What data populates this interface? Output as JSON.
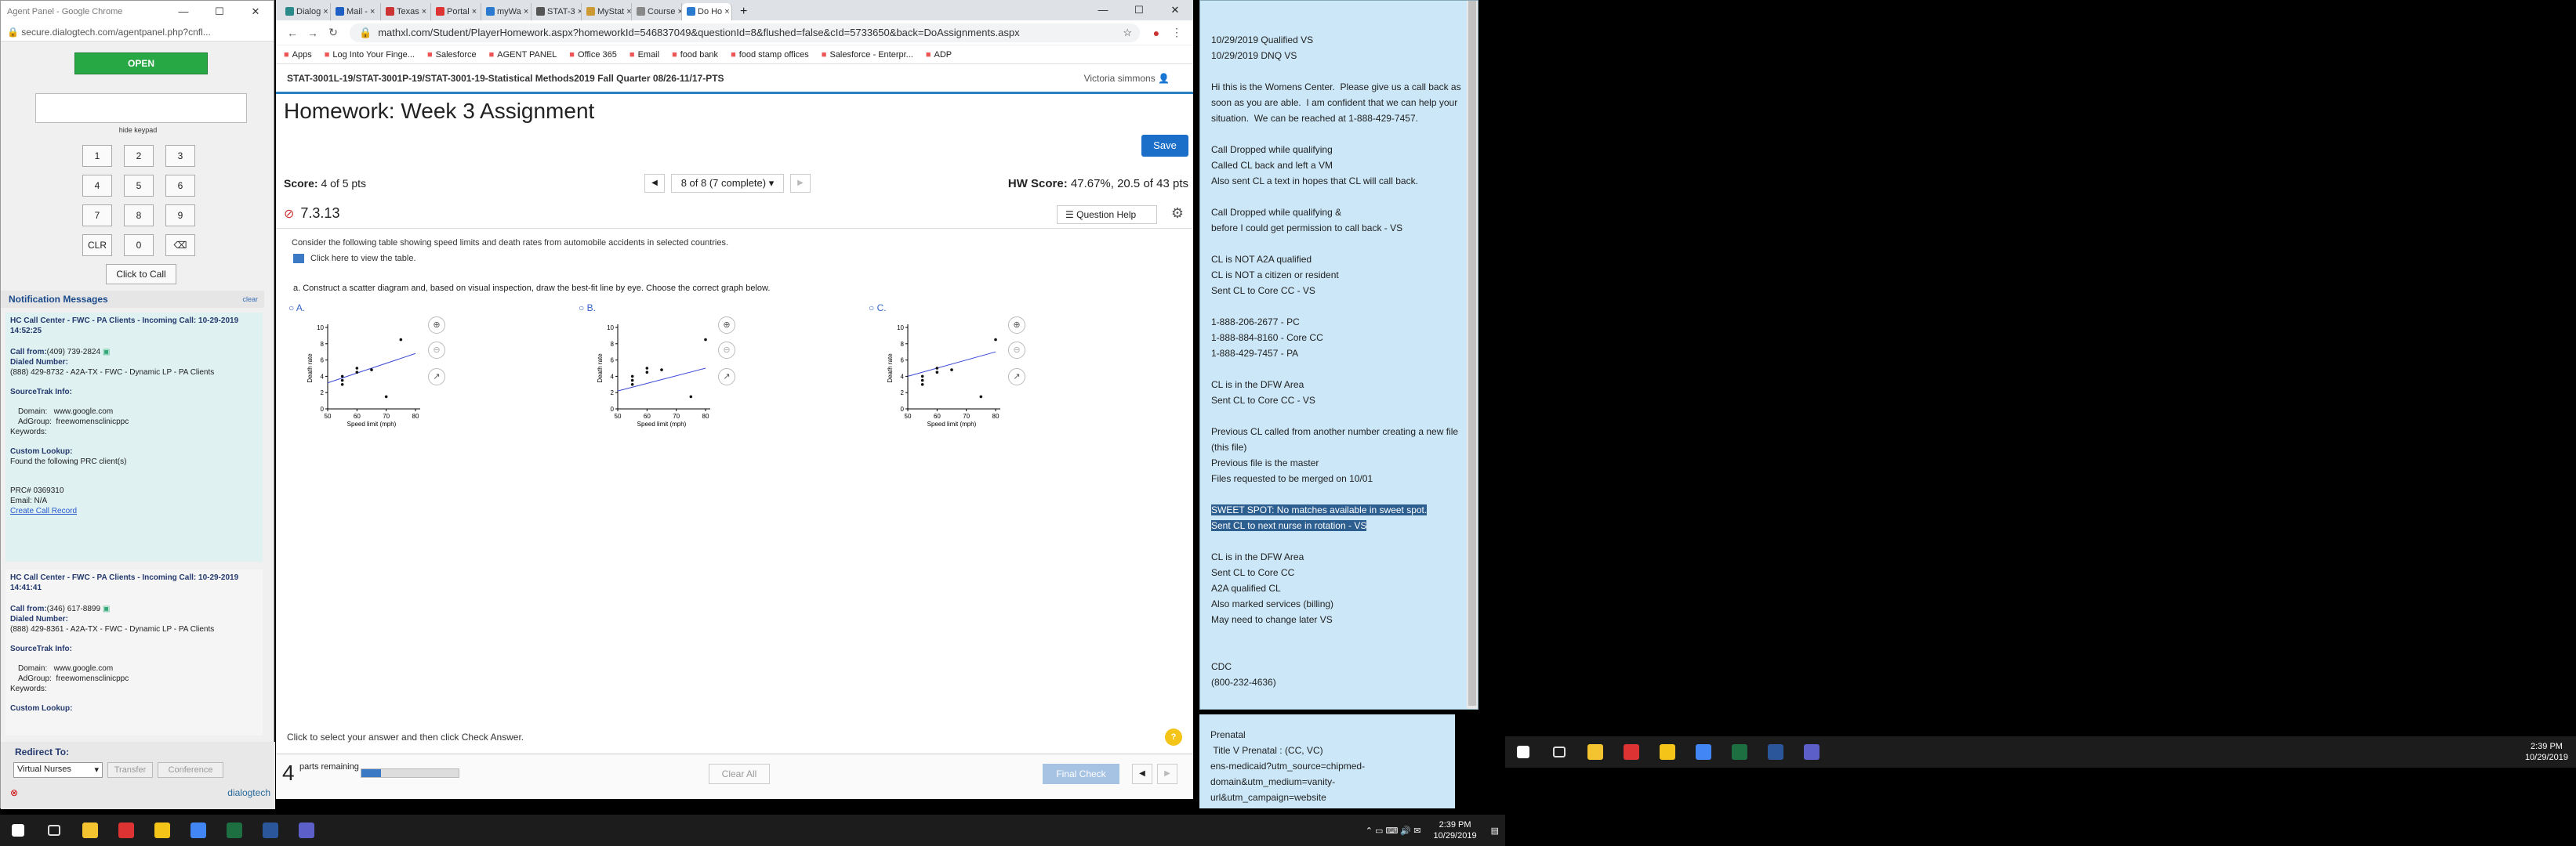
{
  "agent": {
    "window_title": "Agent Panel - Google Chrome",
    "url": "secure.dialogtech.com/agentpanel.php?cnfl...",
    "open_label": "OPEN",
    "hide_keypad": "hide keypad",
    "keys": [
      "1",
      "2",
      "3",
      "4",
      "5",
      "6",
      "7",
      "8",
      "9",
      "CLR",
      "0",
      "⌫"
    ],
    "click_to_call": "Click to Call",
    "notifications_title": "Notification Messages",
    "clear": "clear",
    "n1": {
      "header": "HC Call Center - FWC - PA Clients - Incoming Call: 10-29-2019 14:52:25",
      "call_from_label": "Call from:",
      "call_from": "(409) 739-2824",
      "dialed_label": "Dialed Number:",
      "dialed": "(888) 429-8732 - A2A-TX - FWC - Dynamic LP - PA Clients",
      "sourcetrak": "SourceTrak Info:",
      "domain_label": "Domain:",
      "domain": "www.google.com",
      "adgroup_label": "AdGroup:",
      "adgroup": "freewomensclinicppc",
      "keywords_label": "Keywords:",
      "custom_label": "Custom Lookup:",
      "custom": "Found the following PRC client(s)",
      "prc": "PRC# 0369310",
      "email": "Email: N/A",
      "create": "Create Call Record"
    },
    "n2": {
      "header": "HC Call Center - FWC - PA Clients - Incoming Call: 10-29-2019 14:41:41",
      "call_from_label": "Call from:",
      "call_from": "(346) 617-8899",
      "dialed_label": "Dialed Number:",
      "dialed": "(888) 429-8361 - A2A-TX - FWC - Dynamic LP - PA Clients",
      "sourcetrak": "SourceTrak Info:",
      "domain_label": "Domain:",
      "domain": "www.google.com",
      "adgroup_label": "AdGroup:",
      "adgroup": "freewomensclinicppc",
      "keywords_label": "Keywords:",
      "custom_label": "Custom Lookup:"
    },
    "redirect_label": "Redirect To:",
    "redirect_value": "Virtual Nurses",
    "transfer": "Transfer",
    "conference": "Conference",
    "brand": "dialogtech"
  },
  "browser": {
    "tabs": [
      {
        "label": "Dialog",
        "color": "#2a8a8a"
      },
      {
        "label": "Mail -",
        "color": "#1e5fc4"
      },
      {
        "label": "Texas",
        "color": "#c33"
      },
      {
        "label": "Portal",
        "color": "#d33"
      },
      {
        "label": "myWa",
        "color": "#2a7bd0"
      },
      {
        "label": "STAT-3",
        "color": "#555"
      },
      {
        "label": "MyStat",
        "color": "#c93"
      },
      {
        "label": "Course",
        "color": "#888"
      },
      {
        "label": "Do Ho",
        "color": "#2a7bd0"
      }
    ],
    "url": "mathxl.com/Student/PlayerHomework.aspx?homeworkId=546837049&questionId=8&flushed=false&cId=5733650&back=DoAssignments.aspx",
    "bookmarks": [
      "Apps",
      "Log Into Your Finge...",
      "Salesforce",
      "AGENT PANEL",
      "Office 365",
      "Email",
      "food bank",
      "food stamp offices",
      "Salesforce - Enterpr...",
      "ADP"
    ],
    "course": "STAT-3001L-19/STAT-3001P-19/STAT-3001-19-Statistical Methods2019 Fall Quarter 08/26-11/17-PTS",
    "user": "Victoria simmons",
    "hw_title": "Homework: Week 3 Assignment",
    "save": "Save",
    "score_label": "Score:",
    "score": "4 of 5 pts",
    "pager": "8 of 8 (7 complete)",
    "hw_score_label": "HW Score:",
    "hw_score": "47.67%, 20.5 of 43 pts",
    "question_num": "7.3.13",
    "question_help": "Question Help",
    "question_text": "Consider the following table showing speed limits and death rates from automobile accidents in selected countries.",
    "table_link": "Click here to view the table.",
    "part_a": "a. Construct a scatter diagram and, based on visual inspection, draw the best-fit line by eye. Choose the correct graph below.",
    "options": [
      "A.",
      "B.",
      "C."
    ],
    "bottom_hint": "Click to select your answer and then click Check Answer.",
    "parts_num": "4",
    "parts_text": "parts remaining",
    "progress": 0.2,
    "clear_all": "Clear All",
    "final_check": "Final Check"
  },
  "chart_data": [
    {
      "type": "scatter",
      "xlabel": "Speed limit (mph)",
      "ylabel": "Death rate",
      "xlim": [
        50,
        80
      ],
      "ylim": [
        0,
        10
      ],
      "xticks": [
        50,
        60,
        70,
        80
      ],
      "yticks": [
        0,
        2,
        4,
        6,
        8,
        10
      ],
      "points": [
        [
          55,
          3.0
        ],
        [
          55,
          3.5
        ],
        [
          55,
          4.0
        ],
        [
          60,
          4.5
        ],
        [
          60,
          5.0
        ],
        [
          65,
          4.8
        ],
        [
          70,
          1.5
        ],
        [
          75,
          8.5
        ]
      ],
      "line": [
        [
          50,
          3.2
        ],
        [
          80,
          6.8
        ]
      ]
    },
    {
      "type": "scatter",
      "xlabel": "Speed limit (mph)",
      "ylabel": "Death rate",
      "xlim": [
        50,
        80
      ],
      "ylim": [
        0,
        10
      ],
      "xticks": [
        50,
        60,
        70,
        80
      ],
      "yticks": [
        0,
        2,
        4,
        6,
        8,
        10
      ],
      "points": [
        [
          55,
          3.0
        ],
        [
          55,
          3.5
        ],
        [
          55,
          4.0
        ],
        [
          60,
          4.5
        ],
        [
          60,
          5.0
        ],
        [
          65,
          4.8
        ],
        [
          75,
          1.5
        ],
        [
          80,
          8.5
        ]
      ],
      "line": [
        [
          50,
          2.2
        ],
        [
          80,
          5.0
        ]
      ]
    },
    {
      "type": "scatter",
      "xlabel": "Speed limit (mph)",
      "ylabel": "Death rate",
      "xlim": [
        50,
        80
      ],
      "ylim": [
        0,
        10
      ],
      "xticks": [
        50,
        60,
        70,
        80
      ],
      "yticks": [
        0,
        2,
        4,
        6,
        8,
        10
      ],
      "points": [
        [
          55,
          3.0
        ],
        [
          55,
          3.5
        ],
        [
          55,
          4.0
        ],
        [
          60,
          4.5
        ],
        [
          60,
          5.0
        ],
        [
          65,
          4.8
        ],
        [
          75,
          1.5
        ],
        [
          80,
          8.5
        ]
      ],
      "line": [
        [
          50,
          4.0
        ],
        [
          80,
          7.0
        ]
      ]
    }
  ],
  "notes": {
    "text_before": "10/29/2019 Qualified VS\n10/29/2019 DNQ VS\n\nHi this is the Womens Center.  Please give us a call back as soon as you are able.  I am confident that we can help your situation.  We can be reached at 1-888-429-7457.\n\nCall Dropped while qualifying\nCalled CL back and left a VM\nAlso sent CL a text in hopes that CL will call back.\n\nCall Dropped while qualifying &\nbefore I could get permission to call back - VS\n\nCL is NOT A2A qualified\nCL is NOT a citizen or resident\nSent CL to Core CC - VS\n\n1-888-206-2677 - PC\n1-888-884-8160 - Core CC\n1-888-429-7457 - PA\n\nCL is in the DFW Area\nSent CL to Core CC - VS\n\nPrevious CL called from another number creating a new file (this file)\nPrevious file is the master\nFiles requested to be merged on 10/01\n\n",
    "highlight": "SWEET SPOT: No matches available in sweet spot.\nSent CL to next nurse in rotation - VS",
    "text_after": "\n\nCL is in the DFW Area\nSent CL to Core CC\nA2A qualified CL\nAlso marked services (billing)\nMay need to change later VS\n\n\nCDC\n(800-232-4636)",
    "lower": "Prenatal\n Title V Prenatal : (CC, VC)\nens-medicaid?utm_source=chipmed-domain&utm_medium=vanity-url&utm_campaign=website"
  },
  "taskbar": {
    "time": "2:39 PM",
    "date": "10/29/2019",
    "icons": [
      "windows-start",
      "task-view",
      "file-explorer",
      "chrome-red",
      "sticky-notes",
      "chrome",
      "excel",
      "word",
      "teams"
    ],
    "icon_colors": [
      "#fff",
      "#ddd",
      "#f4c430",
      "#d33",
      "#f4c518",
      "#4285f4",
      "#1d6f42",
      "#2b579a",
      "#5b5fc7"
    ]
  }
}
